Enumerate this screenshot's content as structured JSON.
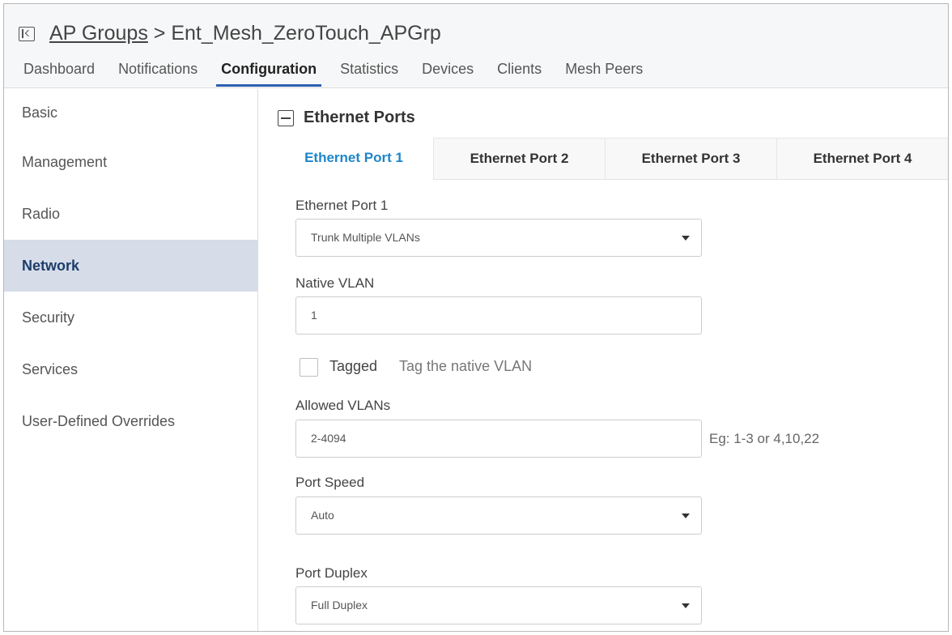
{
  "header": {
    "breadcrumb_link": "AP Groups",
    "breadcrumb_rest": " > Ent_Mesh_ZeroTouch_APGrp",
    "tabs": [
      {
        "label": "Dashboard"
      },
      {
        "label": "Notifications"
      },
      {
        "label": "Configuration",
        "active": true
      },
      {
        "label": "Statistics"
      },
      {
        "label": "Devices"
      },
      {
        "label": "Clients"
      },
      {
        "label": "Mesh Peers"
      }
    ]
  },
  "sidebar": {
    "items": [
      {
        "label": "Basic"
      },
      {
        "label": "Management"
      },
      {
        "label": "Radio"
      },
      {
        "label": "Network",
        "active": true
      },
      {
        "label": "Security"
      },
      {
        "label": "Services"
      },
      {
        "label": "User-Defined Overrides"
      }
    ]
  },
  "main": {
    "section_title": "Ethernet Ports",
    "port_tabs": [
      {
        "label": "Ethernet Port 1",
        "active": true
      },
      {
        "label": "Ethernet Port 2"
      },
      {
        "label": "Ethernet Port 3"
      },
      {
        "label": "Ethernet Port 4"
      }
    ],
    "port_mode": {
      "label": "Ethernet Port 1",
      "value": "Trunk Multiple VLANs"
    },
    "native_vlan": {
      "label": "Native VLAN",
      "value": "1"
    },
    "tagged": {
      "label": "Tagged",
      "description": "Tag the native VLAN",
      "checked": false
    },
    "allowed_vlans": {
      "label": "Allowed VLANs",
      "value": "2-4094",
      "hint": "Eg: 1-3 or 4,10,22"
    },
    "port_speed": {
      "label": "Port Speed",
      "value": "Auto"
    },
    "port_duplex": {
      "label": "Port Duplex",
      "value": "Full Duplex"
    }
  },
  "colors": {
    "active_tab_underline": "#2b5fb4",
    "active_port_tab_text": "#1d86c9",
    "sidebar_active_bg": "#d6dde9"
  }
}
